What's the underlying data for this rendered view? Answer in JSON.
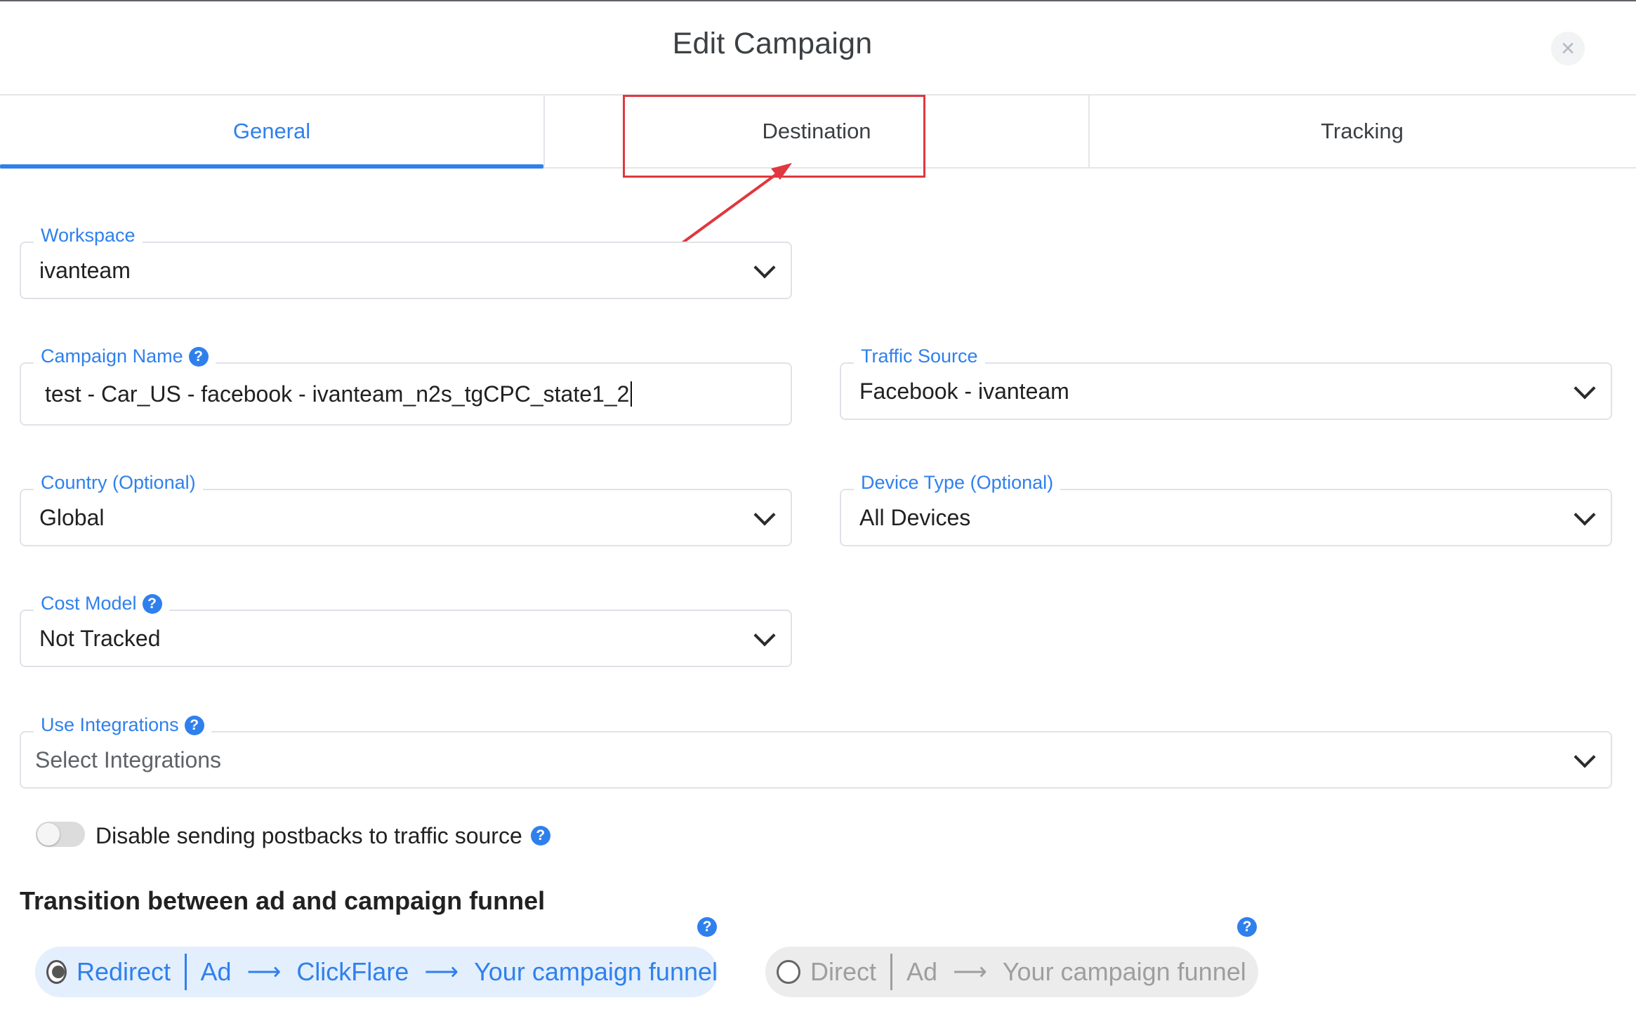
{
  "modal": {
    "title": "Edit Campaign",
    "close_icon": "×"
  },
  "tabs": [
    {
      "label": "General",
      "active": true
    },
    {
      "label": "Destination",
      "active": false
    },
    {
      "label": "Tracking",
      "active": false
    }
  ],
  "fields": {
    "workspace": {
      "label": "Workspace",
      "value": "ivanteam"
    },
    "campaign_name": {
      "label": "Campaign Name",
      "value": "test - Car_US - facebook - ivanteam_n2s_tgCPC_state1_2"
    },
    "traffic_source": {
      "label": "Traffic Source",
      "value": "Facebook - ivanteam"
    },
    "country": {
      "label": "Country (Optional)",
      "value": "Global"
    },
    "device_type": {
      "label": "Device Type (Optional)",
      "value": "All Devices"
    },
    "cost_model": {
      "label": "Cost Model",
      "value": "Not Tracked"
    },
    "integrations": {
      "label": "Use Integrations",
      "placeholder": "Select Integrations"
    }
  },
  "toggle": {
    "label": "Disable sending postbacks to traffic source",
    "checked": false
  },
  "transition": {
    "title": "Transition between ad and campaign funnel",
    "redirect": {
      "label": "Redirect",
      "selected": true,
      "steps": [
        "Ad",
        "ClickFlare",
        "Your campaign funnel"
      ]
    },
    "direct": {
      "label": "Direct",
      "selected": false,
      "steps": [
        "Ad",
        "Your campaign funnel"
      ]
    }
  },
  "help_glyph": "?",
  "colors": {
    "accent": "#2f80ed",
    "annotation": "#e0383e",
    "redirect_bg": "#e3effd",
    "direct_bg": "#ececec"
  }
}
